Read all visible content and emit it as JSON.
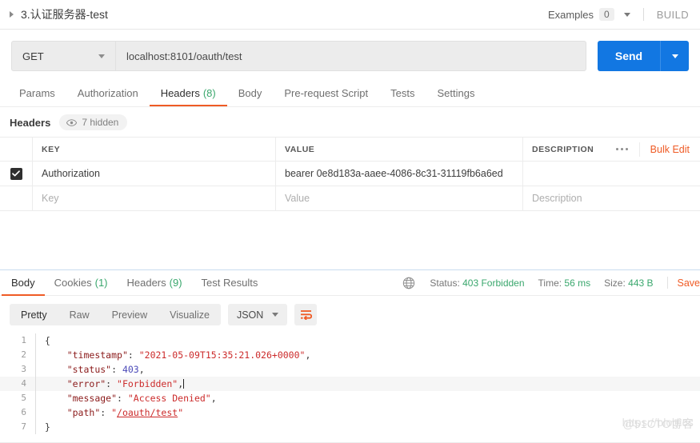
{
  "header": {
    "request_title": "3.认证服务器-test",
    "expand_icon": "caret-right-icon",
    "examples_label": "Examples",
    "examples_count": "0",
    "build_label": "BUILD"
  },
  "url_bar": {
    "method": "GET",
    "url": "localhost:8101/oauth/test",
    "send_label": "Send"
  },
  "request_tabs": [
    {
      "label": "Params",
      "count": "",
      "active": false
    },
    {
      "label": "Authorization",
      "count": "",
      "active": false
    },
    {
      "label": "Headers",
      "count": "(8)",
      "active": true
    },
    {
      "label": "Body",
      "count": "",
      "active": false
    },
    {
      "label": "Pre-request Script",
      "count": "",
      "active": false
    },
    {
      "label": "Tests",
      "count": "",
      "active": false
    },
    {
      "label": "Settings",
      "count": "",
      "active": false
    }
  ],
  "headers_section": {
    "title": "Headers",
    "hidden_pill": "7 hidden",
    "eye_icon": "eye-icon",
    "columns": [
      "KEY",
      "VALUE",
      "DESCRIPTION"
    ],
    "more_icon": "ellipsis-icon",
    "bulk_edit_label": "Bulk Edit",
    "rows": [
      {
        "checked": true,
        "key": "Authorization",
        "value": "bearer 0e8d183a-aaee-4086-8c31-31119fb6a6ed",
        "description": ""
      }
    ],
    "placeholder_row": {
      "key": "Key",
      "value": "Value",
      "description": "Description"
    }
  },
  "response": {
    "tabs": [
      {
        "label": "Body",
        "count": "",
        "active": true
      },
      {
        "label": "Cookies",
        "count": "(1)",
        "active": false
      },
      {
        "label": "Headers",
        "count": "(9)",
        "active": false
      },
      {
        "label": "Test Results",
        "count": "",
        "active": false
      }
    ],
    "globe_icon": "globe-icon",
    "status_label": "Status:",
    "status_value": "403 Forbidden",
    "time_label": "Time:",
    "time_value": "56 ms",
    "size_label": "Size:",
    "size_value": "443 B",
    "save_label": "Save",
    "view_modes": [
      {
        "label": "Pretty",
        "active": true
      },
      {
        "label": "Raw",
        "active": false
      },
      {
        "label": "Preview",
        "active": false
      },
      {
        "label": "Visualize",
        "active": false
      }
    ],
    "format": "JSON",
    "wrap_icon": "word-wrap-icon",
    "body_lines": [
      {
        "num": "1",
        "indent": 0,
        "tokens": [
          {
            "t": "p",
            "v": "{"
          }
        ]
      },
      {
        "num": "2",
        "indent": 1,
        "tokens": [
          {
            "t": "k",
            "v": "\"timestamp\""
          },
          {
            "t": "p",
            "v": ": "
          },
          {
            "t": "s",
            "v": "\"2021-05-09T15:35:21.026+0000\""
          },
          {
            "t": "p",
            "v": ","
          }
        ]
      },
      {
        "num": "3",
        "indent": 1,
        "tokens": [
          {
            "t": "k",
            "v": "\"status\""
          },
          {
            "t": "p",
            "v": ": "
          },
          {
            "t": "n",
            "v": "403"
          },
          {
            "t": "p",
            "v": ","
          }
        ]
      },
      {
        "num": "4",
        "indent": 1,
        "highlight": true,
        "caret": true,
        "tokens": [
          {
            "t": "k",
            "v": "\"error\""
          },
          {
            "t": "p",
            "v": ": "
          },
          {
            "t": "s",
            "v": "\"Forbidden\""
          },
          {
            "t": "p",
            "v": ","
          }
        ]
      },
      {
        "num": "5",
        "indent": 1,
        "tokens": [
          {
            "t": "k",
            "v": "\"message\""
          },
          {
            "t": "p",
            "v": ": "
          },
          {
            "t": "s",
            "v": "\"Access Denied\""
          },
          {
            "t": "p",
            "v": ","
          }
        ]
      },
      {
        "num": "6",
        "indent": 1,
        "tokens": [
          {
            "t": "k",
            "v": "\"path\""
          },
          {
            "t": "p",
            "v": ": "
          },
          {
            "t": "s",
            "v": "\""
          },
          {
            "t": "lnk",
            "v": "/oauth/test"
          },
          {
            "t": "s",
            "v": "\""
          }
        ]
      },
      {
        "num": "7",
        "indent": 0,
        "tokens": [
          {
            "t": "p",
            "v": "}"
          }
        ]
      }
    ]
  },
  "watermark": {
    "text_a": "https://blog.cs",
    "text_b": "@51CTO博客"
  },
  "colors": {
    "accent_orange": "#ef5b25",
    "send_blue": "#1277e2",
    "status_green": "#3aa76d"
  }
}
